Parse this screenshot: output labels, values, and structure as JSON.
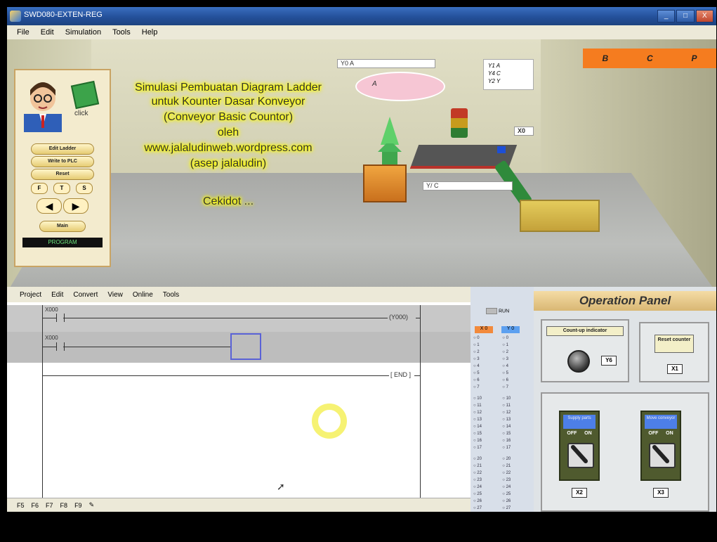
{
  "window": {
    "title": "SWD080-EXTEN-REG",
    "buttons": [
      "_",
      "□",
      "X"
    ]
  },
  "menubar": [
    "File",
    "Edit",
    "Simulation",
    "Tools",
    "Help"
  ],
  "control_panel": {
    "click_label": "click",
    "buttons": [
      "Edit Ladder",
      "Write to PLC",
      "Reset"
    ],
    "fts": [
      "F",
      "T",
      "S"
    ],
    "main_label": "Main",
    "status": "PROGRAM"
  },
  "caption": {
    "lines": [
      "Simulasi Pembuatan Diagram Ladder",
      "untuk Kounter Dasar Konveyor",
      "(Conveyor Basic Countor)",
      "oleh",
      "www.jalaludinweb.wordpress.com",
      "(asep jalaludin)"
    ],
    "sub": "Cekidot ...",
    "accent": "#ffff00"
  },
  "scene_labels": {
    "y0": "Y0  A",
    "sign_lines": [
      "Y1  A",
      "Y4  C",
      "Y2  Y"
    ],
    "ellipse": "A",
    "x_label": "X0",
    "y_lower": "Y/ C",
    "top_right": [
      "B",
      "C",
      "P"
    ]
  },
  "ladder": {
    "menu": [
      "Project",
      "Edit",
      "Convert",
      "View",
      "Online",
      "Tools"
    ],
    "rung1_contact": "X000",
    "rung1_coil": "Y000",
    "rung2_contact": "X000",
    "end_label": "END",
    "toolbar": [
      "F5",
      "F6",
      "F7",
      "F8",
      "F9"
    ]
  },
  "io_list": {
    "x_header": "X  0",
    "y_header": "Y  0",
    "run_label": "RUN",
    "rows": [
      "0",
      "1",
      "2",
      "3",
      "4",
      "5",
      "6",
      "7",
      "10",
      "11",
      "12",
      "13",
      "14",
      "15",
      "16",
      "17",
      "20",
      "21",
      "22",
      "23",
      "24",
      "25",
      "26",
      "27"
    ]
  },
  "operation_panel": {
    "title": "Operation Panel",
    "count_indicator": "Count-up indicator",
    "y_tag": "Y6",
    "reset_counter": "Reset counter",
    "x_reset_tag": "X1",
    "switch1": {
      "label": "Supply parts",
      "off": "OFF",
      "on": "ON",
      "tag": "X2"
    },
    "switch2": {
      "label": "Move conveyor",
      "off": "OFF",
      "on": "ON",
      "tag": "X3"
    }
  }
}
